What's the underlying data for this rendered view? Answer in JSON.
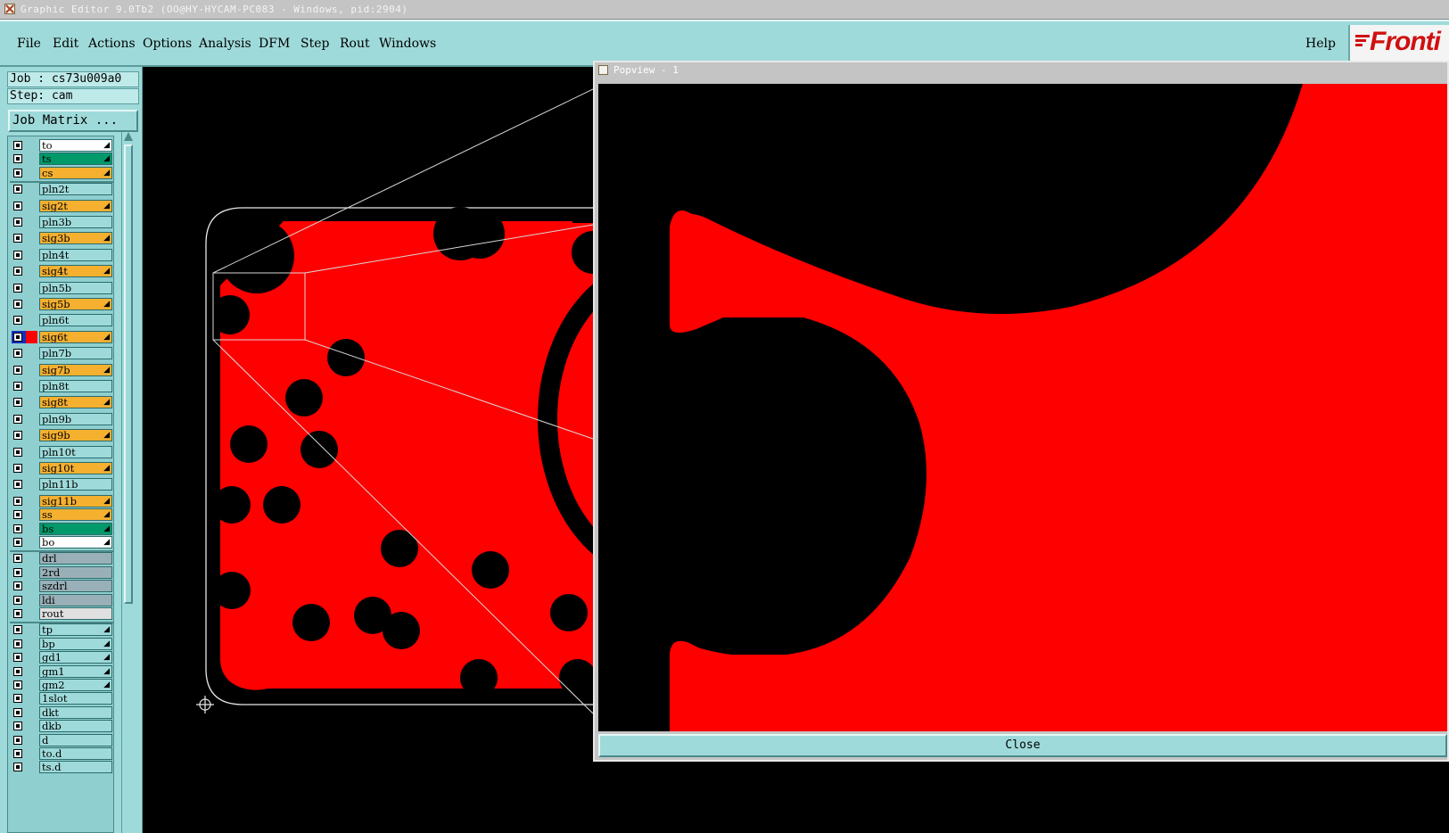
{
  "window": {
    "title": "Graphic Editor 9.0Tb2 (OO@HY-HYCAM-PC083 - Windows, pid:2904)"
  },
  "menu": {
    "items": [
      {
        "label": "File"
      },
      {
        "label": "Edit"
      },
      {
        "label": "Actions"
      },
      {
        "label": "Options"
      },
      {
        "label": "Analysis"
      },
      {
        "label": "DFM"
      },
      {
        "label": "Step"
      },
      {
        "label": "Rout"
      },
      {
        "label": "Windows"
      }
    ],
    "help": "Help",
    "logo": "Fronti"
  },
  "job": {
    "job_label": "Job : cs73u009a0",
    "step_label": "Step: cam",
    "matrix_button": "Job Matrix ..."
  },
  "layers": [
    {
      "name": "to",
      "color": "#ffffff",
      "arrow": true
    },
    {
      "name": "ts",
      "color": "#009a6a",
      "arrow": true
    },
    {
      "name": "cs",
      "color": "#f5b030",
      "arrow": true
    },
    {
      "name": "pln2t",
      "color": "#9fdada",
      "arrow": false
    },
    {
      "name": "sig2t",
      "color": "#f5b030",
      "arrow": true
    },
    {
      "name": "pln3b",
      "color": "#9fdada",
      "arrow": false
    },
    {
      "name": "sig3b",
      "color": "#f5b030",
      "arrow": true
    },
    {
      "name": "pln4t",
      "color": "#9fdada",
      "arrow": false
    },
    {
      "name": "sig4t",
      "color": "#f5b030",
      "arrow": true
    },
    {
      "name": "pln5b",
      "color": "#9fdada",
      "arrow": false
    },
    {
      "name": "sig5b",
      "color": "#f5b030",
      "arrow": true
    },
    {
      "name": "pln6t",
      "color": "#9fdada",
      "arrow": false
    },
    {
      "name": "sig6t",
      "color": "#f5b030",
      "arrow": true,
      "active": true
    },
    {
      "name": "pln7b",
      "color": "#9fdada",
      "arrow": false
    },
    {
      "name": "sig7b",
      "color": "#f5b030",
      "arrow": true
    },
    {
      "name": "pln8t",
      "color": "#9fdada",
      "arrow": false
    },
    {
      "name": "sig8t",
      "color": "#f5b030",
      "arrow": true
    },
    {
      "name": "pln9b",
      "color": "#9fdada",
      "arrow": false
    },
    {
      "name": "sig9b",
      "color": "#f5b030",
      "arrow": true
    },
    {
      "name": "pln10t",
      "color": "#9fdada",
      "arrow": false
    },
    {
      "name": "sig10t",
      "color": "#f5b030",
      "arrow": true
    },
    {
      "name": "pln11b",
      "color": "#9fdada",
      "arrow": false
    },
    {
      "name": "sig11b",
      "color": "#f5b030",
      "arrow": true
    },
    {
      "name": "ss",
      "color": "#f5b030",
      "arrow": true
    },
    {
      "name": "bs",
      "color": "#009a6a",
      "arrow": true
    },
    {
      "name": "bo",
      "color": "#ffffff",
      "arrow": true
    },
    {
      "name": "drl",
      "color": "#9ab0b8",
      "arrow": false
    },
    {
      "name": "2rd",
      "color": "#9ab0b8",
      "arrow": false
    },
    {
      "name": "szdrl",
      "color": "#9ab0b8",
      "arrow": false
    },
    {
      "name": "ldi",
      "color": "#9ab0b8",
      "arrow": false
    },
    {
      "name": "rout",
      "color": "#e0e0e0",
      "arrow": false
    },
    {
      "name": "tp",
      "color": "#9fdada",
      "arrow": true
    },
    {
      "name": "bp",
      "color": "#9fdada",
      "arrow": true
    },
    {
      "name": "gd1",
      "color": "#9fdada",
      "arrow": true
    },
    {
      "name": "gm1",
      "color": "#9fdada",
      "arrow": true
    },
    {
      "name": "gm2",
      "color": "#9fdada",
      "arrow": true
    },
    {
      "name": "1slot",
      "color": "#9fdada",
      "arrow": false
    },
    {
      "name": "dkt",
      "color": "#9fdada",
      "arrow": false
    },
    {
      "name": "dkb",
      "color": "#9fdada",
      "arrow": false
    },
    {
      "name": "d",
      "color": "#9fdada",
      "arrow": false
    },
    {
      "name": "to.d",
      "color": "#9fdada",
      "arrow": false
    },
    {
      "name": "ts.d",
      "color": "#9fdada",
      "arrow": false
    }
  ],
  "popview": {
    "title": "Popview - 1",
    "close_button": "Close"
  },
  "colors": {
    "copper": "#ff0000",
    "panel": "#9fdada",
    "background": "#000000",
    "accent_logo": "#d01010"
  }
}
